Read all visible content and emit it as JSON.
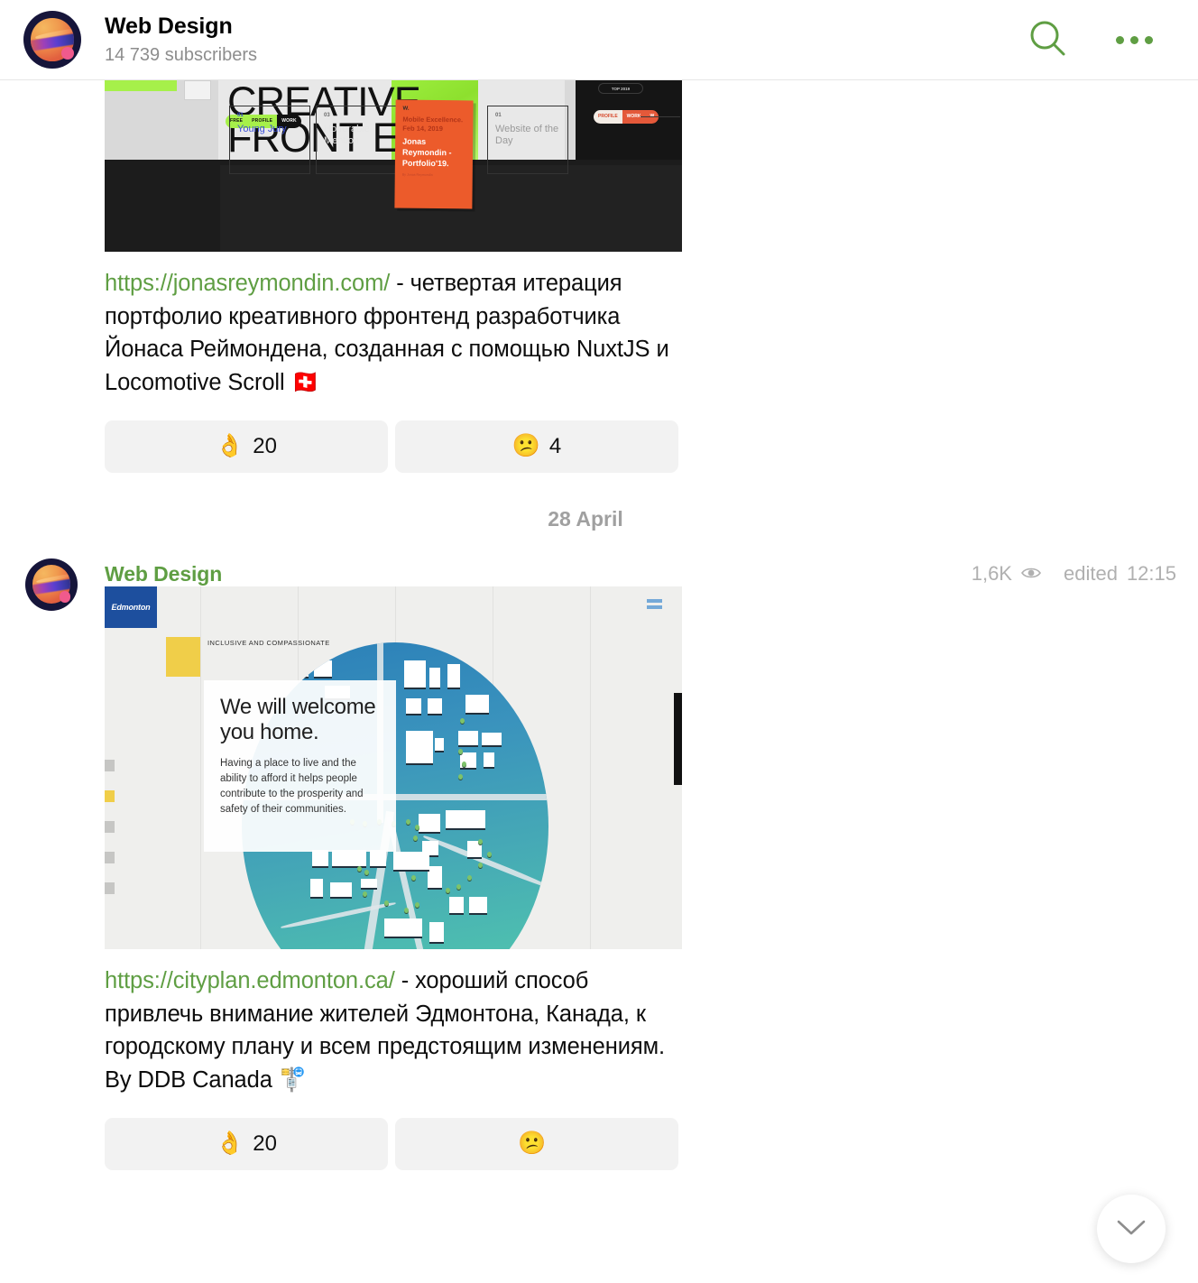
{
  "header": {
    "title": "Web Design",
    "subscribers": "14 739 subscribers",
    "search_icon": "search-icon",
    "menu_icon": "more-options-icon"
  },
  "date_divider": "28 April",
  "posts": [
    {
      "media": {
        "kind": "website-preview",
        "headline_line1": "CREATIVE",
        "headline_line2": "FRONT END",
        "nav_pill": [
          "FREE",
          "PROFILE",
          "WORK"
        ],
        "right_pill_top": "TOP 2019",
        "right_pill": [
          "PROFILE",
          "WORK",
          "W"
        ],
        "award_cards": [
          {
            "num": "01",
            "label": "Young Jury"
          },
          {
            "num": "03",
            "label": "Honorable Mention"
          },
          {
            "num": "01",
            "label": "Website of the Day"
          }
        ],
        "poster": {
          "mark": "W.",
          "line1": "Mobile Excellence.",
          "line2": "Feb 14, 2019",
          "line3": "Jonas Reymondin - Portfolio'19.",
          "line4": "By Jonas Reymondin"
        }
      },
      "caption": {
        "link": "https://jonasreymondin.com/",
        "text": " - четвертая итерация портфолио креативного фронтенд разработчика Йонаса Реймондена, созданная с помощью NuxtJS и Locomotive Scroll ",
        "emoji": "🇨🇭"
      },
      "reactions": [
        {
          "emoji": "👌",
          "count": "20"
        },
        {
          "emoji": "😕",
          "count": "4"
        }
      ]
    },
    {
      "author": "Web Design",
      "views": "1,6K",
      "edited_label": "edited",
      "time": "12:15",
      "media": {
        "kind": "cityplan-site",
        "logo": "Edmonton",
        "eyebrow": "INCLUSIVE AND COMPASSIONATE",
        "headline": "We will welcome you home.",
        "body": "Having a place to live and the ability to afford it helps people contribute to the prosperity and safety of their communities.",
        "menu_icon": "hamburger-icon"
      },
      "caption": {
        "link": "https://cityplan.edmonton.ca/",
        "text": " - хороший способ привлечь внимание жителей Эдмонтона, Канада, к городскому плану и всем предстоящим изменениям. By DDB Canada ",
        "emoji": "🚏"
      },
      "reactions": [
        {
          "emoji": "👌",
          "count": "20"
        },
        {
          "emoji": "😕",
          "count": ""
        }
      ]
    }
  ],
  "scroll_button": {
    "icon": "chevron-down-icon"
  },
  "colors": {
    "accent_green": "#5f9e43",
    "link_green": "#5f9e43",
    "reaction_bg": "#f2f2f2",
    "muted_text": "#a0a0a0"
  }
}
